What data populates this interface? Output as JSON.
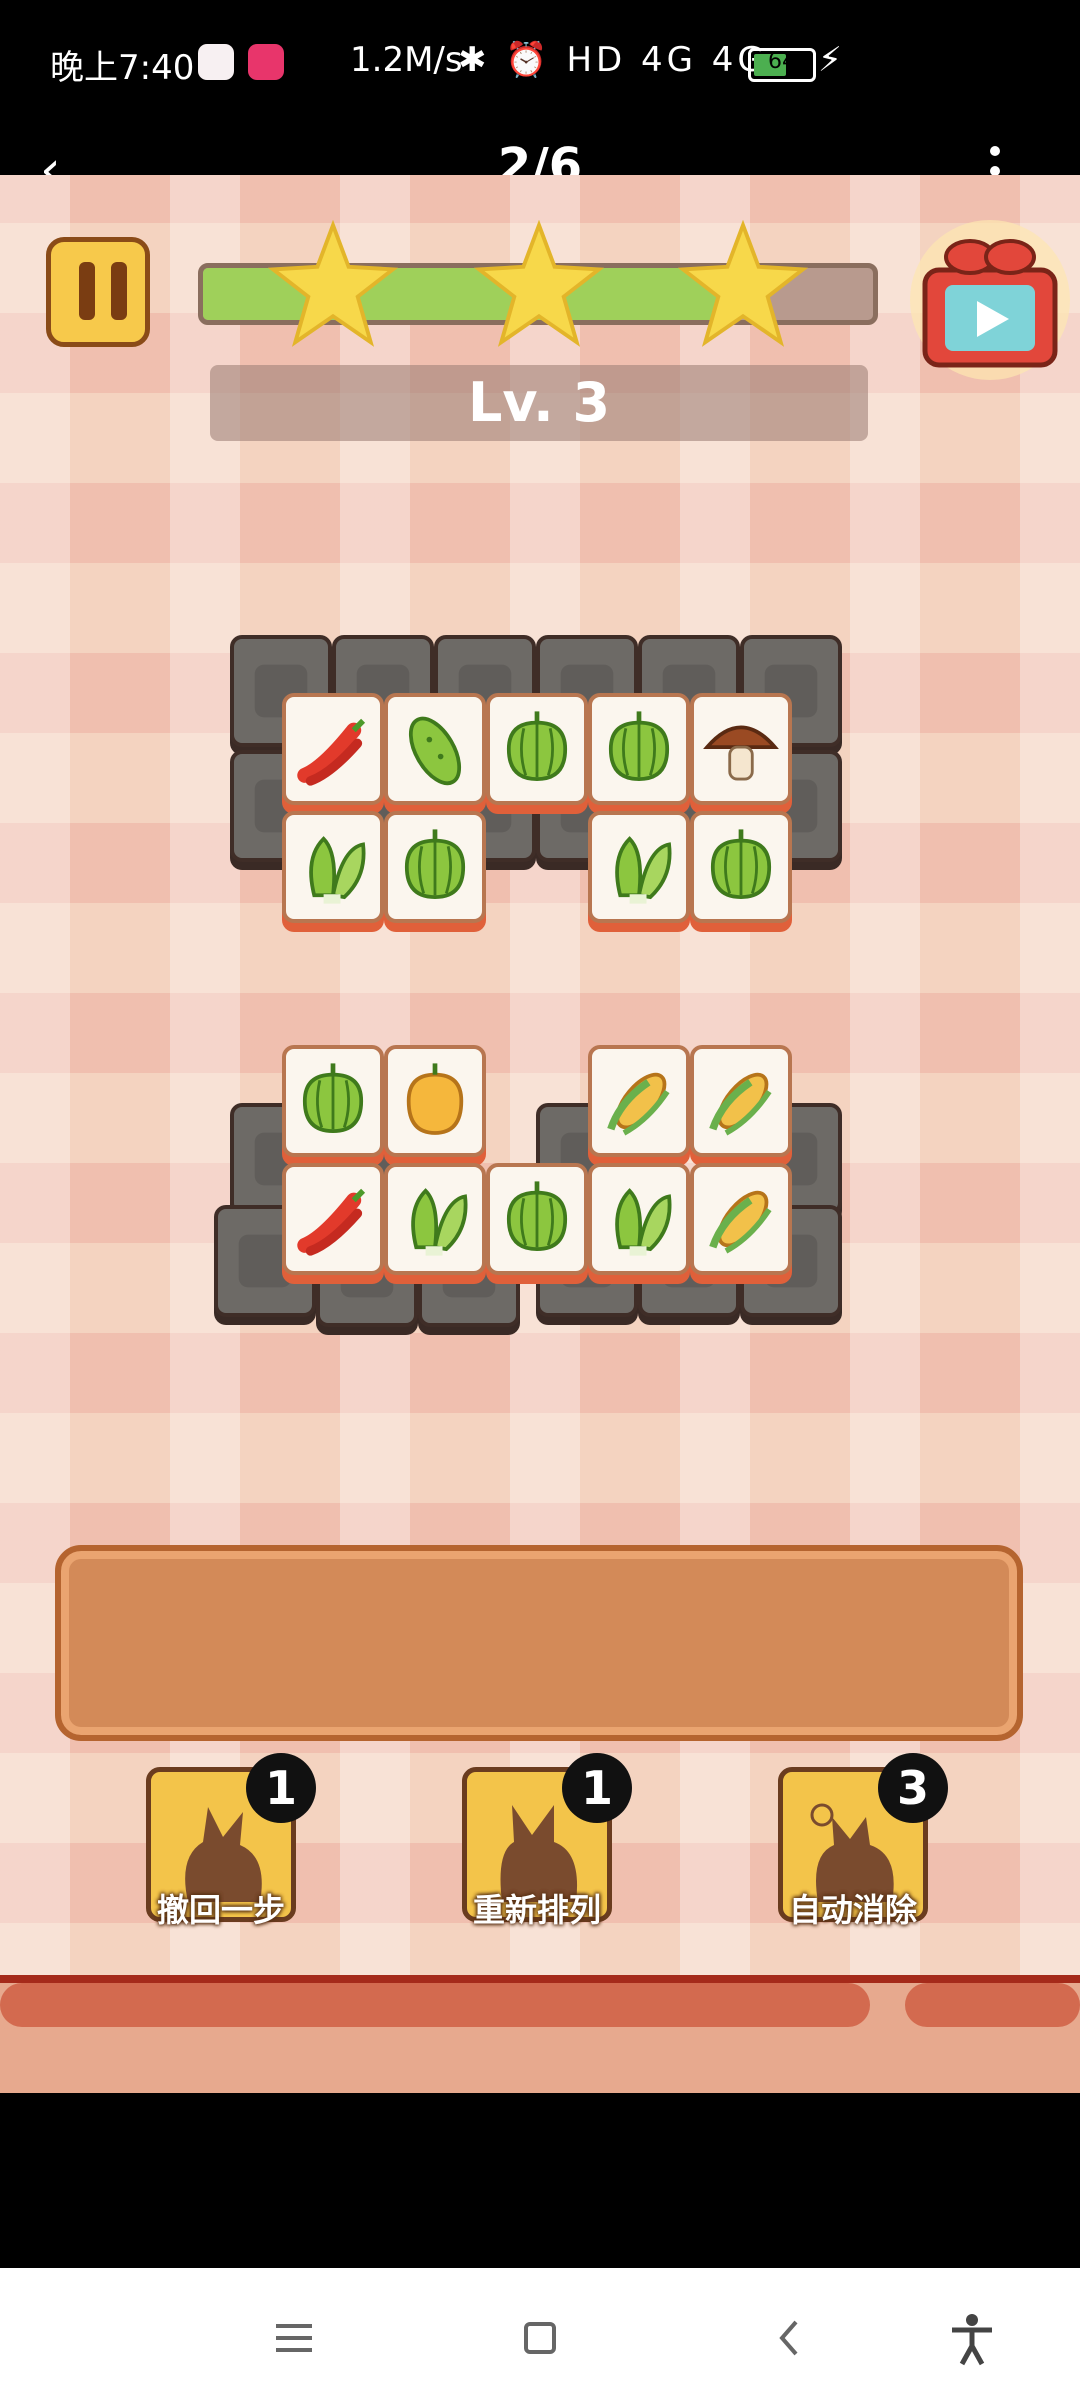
{
  "status_bar": {
    "time": "晚上7:40",
    "speed": "1.2M/s",
    "network_icons": "✱ ⏰ HD 4G 4G",
    "battery": "64",
    "battery_fraction": 0.64
  },
  "header": {
    "page_indicator": "2/6"
  },
  "game": {
    "progress_fraction": 0.78,
    "stars": 3,
    "level_label": "Lv. 3",
    "tools": [
      {
        "label": "撤回一步",
        "count": "1"
      },
      {
        "label": "重新排列",
        "count": "1"
      },
      {
        "label": "自动消除",
        "count": "3"
      }
    ],
    "top_group_front": [
      "chili",
      "cucumber",
      "green-pepper",
      "green-pepper",
      "mushroom",
      "bok-choy",
      "green-pepper",
      "bok-choy",
      "green-pepper"
    ],
    "bottom_group_front": [
      "green-pepper",
      "yellow-pepper",
      "corn",
      "corn",
      "chili",
      "bok-choy",
      "green-pepper",
      "bok-choy",
      "corn"
    ]
  },
  "colors": {
    "background": "#f4d3c0",
    "progress_fill": "#9fd05a",
    "tile_face": "#fbf6ee",
    "tile_edge": "#e0603a",
    "tray": "#d38a58",
    "star": "#f7d84a"
  }
}
